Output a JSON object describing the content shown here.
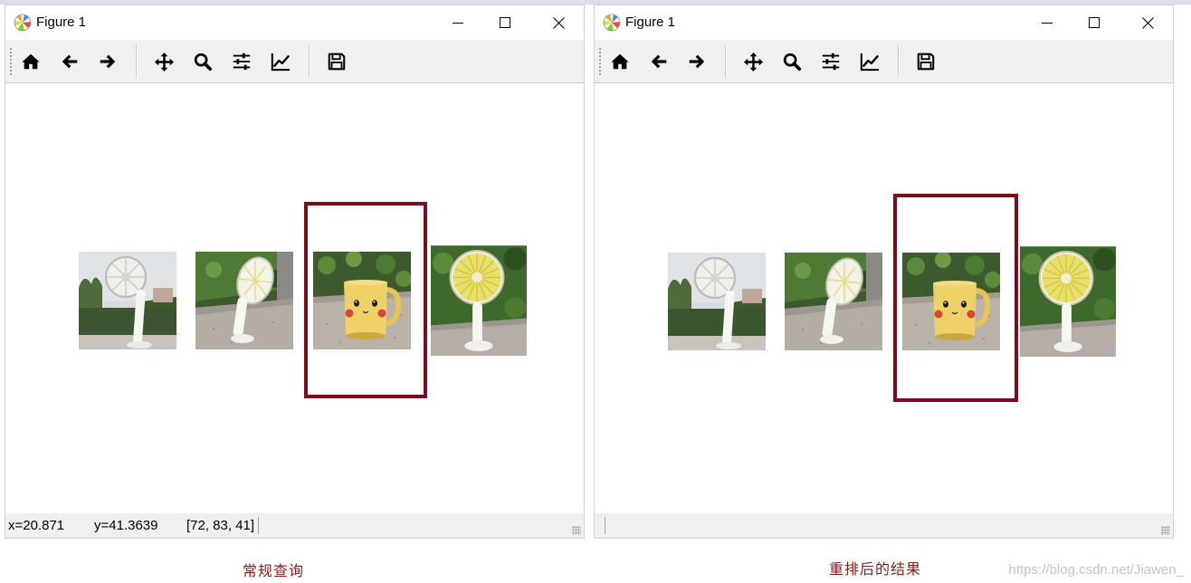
{
  "windows": [
    {
      "title": "Figure 1",
      "status": {
        "x": "x=20.871",
        "y": "y=41.3639",
        "rgb": "[72, 83, 41]"
      },
      "caption": "常规查询"
    },
    {
      "title": "Figure 1",
      "status": {
        "x": "",
        "y": "",
        "rgb": ""
      },
      "caption": "重排后的结果"
    }
  ],
  "toolbar_icons": [
    "home-icon",
    "back-arrow-icon",
    "forward-arrow-icon",
    "pan-icon",
    "zoom-icon",
    "subplots-icon",
    "edit-axes-icon",
    "save-icon"
  ],
  "thumbnails": [
    "fan-garden",
    "fan-ledge",
    "pikachu-mug",
    "yellow-fan"
  ],
  "highlight_color": "#7e0b1b",
  "watermark": "https://blog.csdn.net/Jiawen_"
}
